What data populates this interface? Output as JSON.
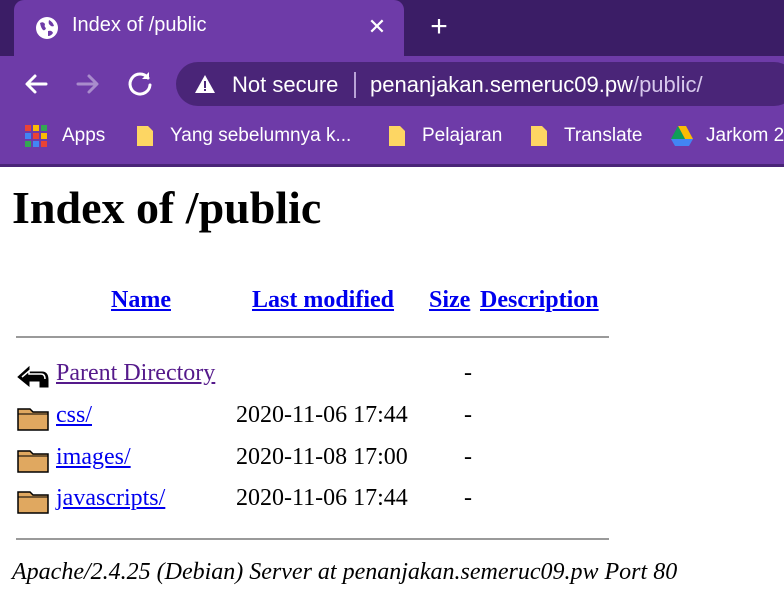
{
  "browser": {
    "tab": {
      "title": "Index of /public",
      "close": "✕"
    },
    "new_tab": "+",
    "omnibox": {
      "security_label": "Not secure",
      "url_host": "penanjakan.semeruc09.pw",
      "url_path": "/public/"
    },
    "bookmarks": [
      {
        "label": "Apps",
        "icon": "apps-grid-icon"
      },
      {
        "label": "Yang sebelumnya k...",
        "icon": "folder-icon"
      },
      {
        "label": "Pelajaran",
        "icon": "folder-icon"
      },
      {
        "label": "Translate",
        "icon": "folder-icon"
      },
      {
        "label": "Jarkom 2",
        "icon": "google-drive-icon"
      }
    ],
    "colors": {
      "tabstrip": "#3b1d66",
      "toolbar": "#6e3ba8",
      "omnibox": "#4a2578"
    }
  },
  "page": {
    "title": "Index of /public",
    "columns": {
      "name": "Name",
      "last_modified": "Last modified",
      "size": "Size",
      "description": "Description"
    },
    "rows": [
      {
        "icon": "back-arrow-icon",
        "name": "Parent Directory",
        "modified": "",
        "size": "-"
      },
      {
        "icon": "folder-icon",
        "name": "css/",
        "modified": "2020-11-06 17:44",
        "size": "-"
      },
      {
        "icon": "folder-icon",
        "name": "images/",
        "modified": "2020-11-08 17:00",
        "size": "-"
      },
      {
        "icon": "folder-icon",
        "name": "javascripts/",
        "modified": "2020-11-06 17:44",
        "size": "-"
      }
    ],
    "footer": "Apache/2.4.25 (Debian) Server at penanjakan.semeruc09.pw Port 80"
  }
}
